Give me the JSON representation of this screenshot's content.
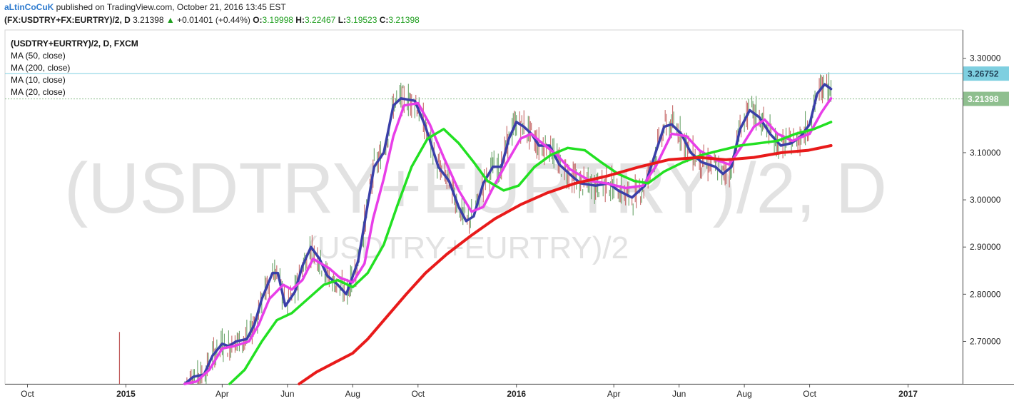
{
  "header": {
    "author": "aLtinCoCuK",
    "published_text": "published on TradingView.com, October 21, 2016 13:45 EST",
    "symbol": "(FX:USDTRY+FX:EURTRY)/2, D",
    "last": "3.21398",
    "change": "+0.01401 (+0.44%)",
    "open_label": "O:",
    "open": "3.19998",
    "high_label": "H:",
    "high": "3.22467",
    "low_label": "L:",
    "low": "3.19523",
    "close_label": "C:",
    "close": "3.21398"
  },
  "legend": {
    "title": "(USDTRY+EURTRY)/2, D, FXCM",
    "items": [
      "MA (50, close)",
      "MA (200, close)",
      "MA (10, close)",
      "MA (20, close)"
    ]
  },
  "watermark": {
    "large": "(USDTRY+EURTRY)/2, D",
    "small": "(USDTRY+EURTRY)/2"
  },
  "chart_data": {
    "type": "line",
    "ylim": [
      2.61,
      3.36
    ],
    "y_ticks": [
      {
        "label": "3.30000",
        "value": 3.3
      },
      {
        "label": "3.10000",
        "value": 3.1
      },
      {
        "label": "3.00000",
        "value": 3.0
      },
      {
        "label": "2.90000",
        "value": 2.9
      },
      {
        "label": "2.80000",
        "value": 2.8
      },
      {
        "label": "2.70000",
        "value": 2.7
      }
    ],
    "x_ticks": [
      {
        "label": "Oct",
        "bold": false,
        "date": "2014-10-01"
      },
      {
        "label": "2015",
        "bold": true,
        "date": "2015-01-01"
      },
      {
        "label": "Apr",
        "bold": false,
        "date": "2015-04-01"
      },
      {
        "label": "Jun",
        "bold": false,
        "date": "2015-06-01"
      },
      {
        "label": "Aug",
        "bold": false,
        "date": "2015-08-01"
      },
      {
        "label": "Oct",
        "bold": false,
        "date": "2015-10-01"
      },
      {
        "label": "2016",
        "bold": true,
        "date": "2016-01-01"
      },
      {
        "label": "Apr",
        "bold": false,
        "date": "2016-04-01"
      },
      {
        "label": "Jun",
        "bold": false,
        "date": "2016-06-01"
      },
      {
        "label": "Aug",
        "bold": false,
        "date": "2016-08-01"
      },
      {
        "label": "Oct",
        "bold": false,
        "date": "2016-10-01"
      },
      {
        "label": "2017",
        "bold": true,
        "date": "2017-01-01"
      }
    ],
    "price_labels": [
      {
        "label": "3.26752",
        "value": 3.26752,
        "color": "#7ecfe0",
        "text_color": "#1f3f55",
        "line": "solid"
      },
      {
        "label": "3.21398",
        "value": 3.21398,
        "color": "#8fbf8f",
        "text_color": "#ffffff",
        "line": "dotted"
      }
    ],
    "series": [
      {
        "name": "MA (10, close)",
        "color": "#3a3fa8",
        "width": 3.5,
        "points": [
          [
            "2015-02-25",
            2.61
          ],
          [
            "2015-03-05",
            2.625
          ],
          [
            "2015-03-15",
            2.63
          ],
          [
            "2015-03-23",
            2.67
          ],
          [
            "2015-04-01",
            2.695
          ],
          [
            "2015-04-07",
            2.69
          ],
          [
            "2015-04-14",
            2.7
          ],
          [
            "2015-04-24",
            2.705
          ],
          [
            "2015-05-01",
            2.735
          ],
          [
            "2015-05-08",
            2.79
          ],
          [
            "2015-05-18",
            2.845
          ],
          [
            "2015-05-23",
            2.845
          ],
          [
            "2015-05-30",
            2.775
          ],
          [
            "2015-06-08",
            2.805
          ],
          [
            "2015-06-15",
            2.86
          ],
          [
            "2015-06-23",
            2.9
          ],
          [
            "2015-07-01",
            2.875
          ],
          [
            "2015-07-08",
            2.84
          ],
          [
            "2015-07-18",
            2.82
          ],
          [
            "2015-07-26",
            2.8
          ],
          [
            "2015-08-06",
            2.87
          ],
          [
            "2015-08-15",
            2.99
          ],
          [
            "2015-08-21",
            3.07
          ],
          [
            "2015-08-30",
            3.1
          ],
          [
            "2015-09-08",
            3.2
          ],
          [
            "2015-09-15",
            3.215
          ],
          [
            "2015-09-28",
            3.21
          ],
          [
            "2015-10-08",
            3.155
          ],
          [
            "2015-10-20",
            3.07
          ],
          [
            "2015-10-30",
            3.04
          ],
          [
            "2015-11-08",
            2.985
          ],
          [
            "2015-11-15",
            2.955
          ],
          [
            "2015-11-22",
            2.965
          ],
          [
            "2015-12-01",
            3.035
          ],
          [
            "2015-12-10",
            3.07
          ],
          [
            "2015-12-18",
            3.07
          ],
          [
            "2015-12-25",
            3.13
          ],
          [
            "2016-01-01",
            3.165
          ],
          [
            "2016-01-08",
            3.155
          ],
          [
            "2016-01-15",
            3.14
          ],
          [
            "2016-01-22",
            3.115
          ],
          [
            "2016-02-01",
            3.115
          ],
          [
            "2016-02-10",
            3.075
          ],
          [
            "2016-02-22",
            3.05
          ],
          [
            "2016-03-01",
            3.035
          ],
          [
            "2016-03-15",
            3.03
          ],
          [
            "2016-03-27",
            3.035
          ],
          [
            "2016-04-05",
            3.02
          ],
          [
            "2016-04-18",
            3.005
          ],
          [
            "2016-04-30",
            3.03
          ],
          [
            "2016-05-10",
            3.1
          ],
          [
            "2016-05-18",
            3.155
          ],
          [
            "2016-05-25",
            3.16
          ],
          [
            "2016-06-03",
            3.14
          ],
          [
            "2016-06-12",
            3.1
          ],
          [
            "2016-06-22",
            3.08
          ],
          [
            "2016-07-05",
            3.07
          ],
          [
            "2016-07-12",
            3.055
          ],
          [
            "2016-07-20",
            3.07
          ],
          [
            "2016-07-28",
            3.15
          ],
          [
            "2016-08-06",
            3.19
          ],
          [
            "2016-08-15",
            3.175
          ],
          [
            "2016-08-25",
            3.14
          ],
          [
            "2016-09-04",
            3.115
          ],
          [
            "2016-09-14",
            3.12
          ],
          [
            "2016-09-23",
            3.135
          ],
          [
            "2016-10-01",
            3.16
          ],
          [
            "2016-10-08",
            3.225
          ],
          [
            "2016-10-15",
            3.245
          ],
          [
            "2016-10-21",
            3.235
          ]
        ]
      },
      {
        "name": "MA (20, close)",
        "color": "#e83ee8",
        "width": 3.5,
        "points": [
          [
            "2015-02-25",
            2.61
          ],
          [
            "2015-03-08",
            2.615
          ],
          [
            "2015-03-20",
            2.64
          ],
          [
            "2015-04-01",
            2.685
          ],
          [
            "2015-04-12",
            2.69
          ],
          [
            "2015-04-26",
            2.7
          ],
          [
            "2015-05-05",
            2.735
          ],
          [
            "2015-05-15",
            2.79
          ],
          [
            "2015-05-28",
            2.82
          ],
          [
            "2015-06-05",
            2.81
          ],
          [
            "2015-06-15",
            2.83
          ],
          [
            "2015-06-25",
            2.875
          ],
          [
            "2015-07-10",
            2.855
          ],
          [
            "2015-07-20",
            2.835
          ],
          [
            "2015-08-01",
            2.825
          ],
          [
            "2015-08-12",
            2.865
          ],
          [
            "2015-08-20",
            2.96
          ],
          [
            "2015-08-30",
            3.045
          ],
          [
            "2015-09-08",
            3.135
          ],
          [
            "2015-09-18",
            3.2
          ],
          [
            "2015-10-01",
            3.205
          ],
          [
            "2015-10-12",
            3.16
          ],
          [
            "2015-10-25",
            3.09
          ],
          [
            "2015-11-08",
            3.02
          ],
          [
            "2015-11-20",
            2.975
          ],
          [
            "2015-12-01",
            2.985
          ],
          [
            "2015-12-10",
            3.025
          ],
          [
            "2015-12-22",
            3.075
          ],
          [
            "2016-01-05",
            3.13
          ],
          [
            "2016-01-15",
            3.14
          ],
          [
            "2016-01-25",
            3.12
          ],
          [
            "2016-02-08",
            3.095
          ],
          [
            "2016-02-20",
            3.065
          ],
          [
            "2016-03-10",
            3.04
          ],
          [
            "2016-03-25",
            3.035
          ],
          [
            "2016-04-12",
            3.025
          ],
          [
            "2016-04-28",
            3.03
          ],
          [
            "2016-05-10",
            3.07
          ],
          [
            "2016-05-25",
            3.14
          ],
          [
            "2016-06-08",
            3.135
          ],
          [
            "2016-06-20",
            3.105
          ],
          [
            "2016-07-05",
            3.085
          ],
          [
            "2016-07-18",
            3.075
          ],
          [
            "2016-07-30",
            3.115
          ],
          [
            "2016-08-10",
            3.155
          ],
          [
            "2016-08-20",
            3.17
          ],
          [
            "2016-09-01",
            3.14
          ],
          [
            "2016-09-15",
            3.125
          ],
          [
            "2016-10-01",
            3.14
          ],
          [
            "2016-10-12",
            3.185
          ],
          [
            "2016-10-21",
            3.215
          ]
        ]
      },
      {
        "name": "MA (50, close)",
        "color": "#22e022",
        "width": 3.5,
        "points": [
          [
            "2015-04-08",
            2.61
          ],
          [
            "2015-04-22",
            2.64
          ],
          [
            "2015-05-08",
            2.7
          ],
          [
            "2015-05-22",
            2.745
          ],
          [
            "2015-06-05",
            2.76
          ],
          [
            "2015-06-20",
            2.79
          ],
          [
            "2015-07-05",
            2.82
          ],
          [
            "2015-07-18",
            2.83
          ],
          [
            "2015-08-01",
            2.815
          ],
          [
            "2015-08-15",
            2.845
          ],
          [
            "2015-08-30",
            2.905
          ],
          [
            "2015-09-12",
            2.99
          ],
          [
            "2015-09-25",
            3.07
          ],
          [
            "2015-10-10",
            3.13
          ],
          [
            "2015-10-25",
            3.15
          ],
          [
            "2015-11-08",
            3.12
          ],
          [
            "2015-11-22",
            3.08
          ],
          [
            "2015-12-05",
            3.04
          ],
          [
            "2015-12-20",
            3.02
          ],
          [
            "2016-01-03",
            3.03
          ],
          [
            "2016-01-18",
            3.07
          ],
          [
            "2016-02-02",
            3.095
          ],
          [
            "2016-02-18",
            3.11
          ],
          [
            "2016-03-05",
            3.105
          ],
          [
            "2016-03-20",
            3.08
          ],
          [
            "2016-04-05",
            3.055
          ],
          [
            "2016-04-20",
            3.04
          ],
          [
            "2016-05-03",
            3.035
          ],
          [
            "2016-05-18",
            3.06
          ],
          [
            "2016-06-05",
            3.08
          ],
          [
            "2016-06-22",
            3.095
          ],
          [
            "2016-07-10",
            3.105
          ],
          [
            "2016-07-28",
            3.115
          ],
          [
            "2016-08-15",
            3.12
          ],
          [
            "2016-09-01",
            3.125
          ],
          [
            "2016-09-18",
            3.14
          ],
          [
            "2016-10-05",
            3.15
          ],
          [
            "2016-10-21",
            3.165
          ]
        ]
      },
      {
        "name": "MA (200, close)",
        "color": "#e81a1a",
        "width": 4,
        "points": [
          [
            "2015-06-12",
            2.61
          ],
          [
            "2015-06-28",
            2.635
          ],
          [
            "2015-07-15",
            2.655
          ],
          [
            "2015-08-01",
            2.675
          ],
          [
            "2015-08-15",
            2.705
          ],
          [
            "2015-09-01",
            2.75
          ],
          [
            "2015-09-20",
            2.8
          ],
          [
            "2015-10-08",
            2.845
          ],
          [
            "2015-10-28",
            2.885
          ],
          [
            "2015-11-20",
            2.925
          ],
          [
            "2015-12-12",
            2.96
          ],
          [
            "2016-01-05",
            2.99
          ],
          [
            "2016-01-30",
            3.015
          ],
          [
            "2016-02-25",
            3.035
          ],
          [
            "2016-03-25",
            3.05
          ],
          [
            "2016-04-25",
            3.07
          ],
          [
            "2016-05-22",
            3.085
          ],
          [
            "2016-06-20",
            3.09
          ],
          [
            "2016-07-15",
            3.085
          ],
          [
            "2016-08-10",
            3.09
          ],
          [
            "2016-09-05",
            3.1
          ],
          [
            "2016-09-30",
            3.105
          ],
          [
            "2016-10-21",
            3.115
          ]
        ]
      }
    ]
  }
}
